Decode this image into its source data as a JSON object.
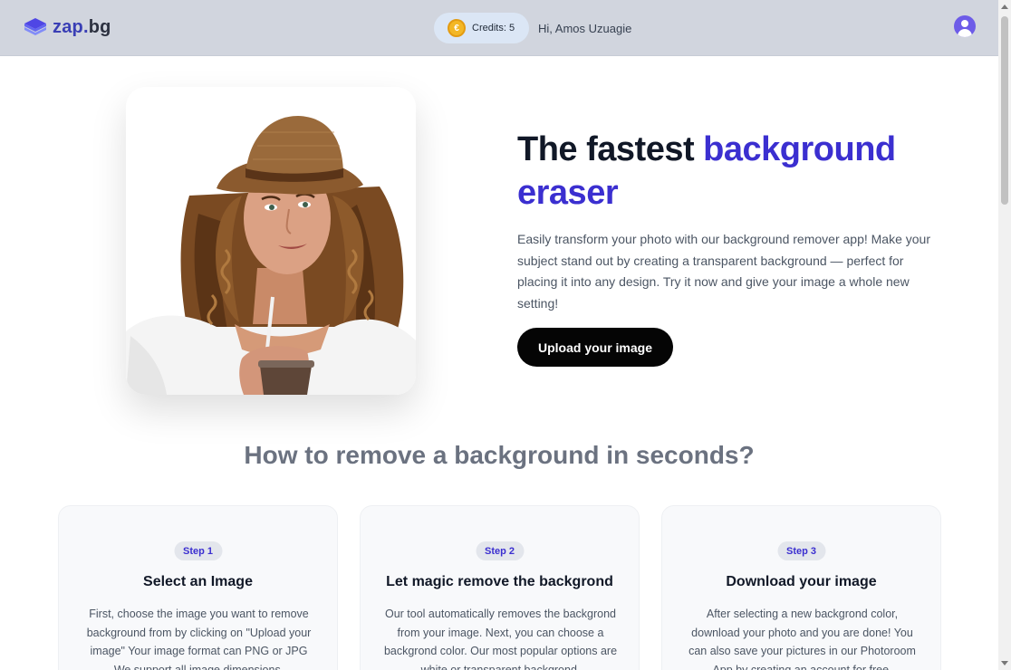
{
  "header": {
    "logo_name": "zap",
    "logo_dot": ".",
    "logo_tld": "bg",
    "credits_label": "Credits: 5",
    "greeting": "Hi, Amos Uzuagie"
  },
  "hero": {
    "title_plain": "The fastest ",
    "title_accent": "background eraser",
    "description": "Easily transform your photo with our background remover app! Make your subject stand out by creating a transparent background — perfect for placing it into any design. Try it now and give your image a whole new setting!",
    "upload_label": "Upload your image"
  },
  "how_to": {
    "title": "How to remove a background in seconds?",
    "steps": [
      {
        "badge": "Step 1",
        "title": "Select an Image",
        "text": "First, choose the image you want to remove background from by clicking on \"Upload your image\" Your image format can PNG or JPG We support all image dimensions."
      },
      {
        "badge": "Step 2",
        "title": "Let magic remove the backgrond",
        "text": "Our tool automatically removes the backgrond from your image. Next, you can choose a backgrond color. Our most popular options are white or transparent backgrond."
      },
      {
        "badge": "Step 3",
        "title": "Download your image",
        "text": "After selecting a new backgrond color, download your photo and you are done! You can also save your pictures in our Photoroom App by creating an account for free."
      }
    ]
  },
  "colors": {
    "accent": "#3b2fd0",
    "header_bg": "#d1d5de",
    "button_bg": "#050505"
  },
  "icons": {
    "logo": "layers-icon",
    "credits": "coin-icon",
    "account": "user-avatar-icon"
  }
}
